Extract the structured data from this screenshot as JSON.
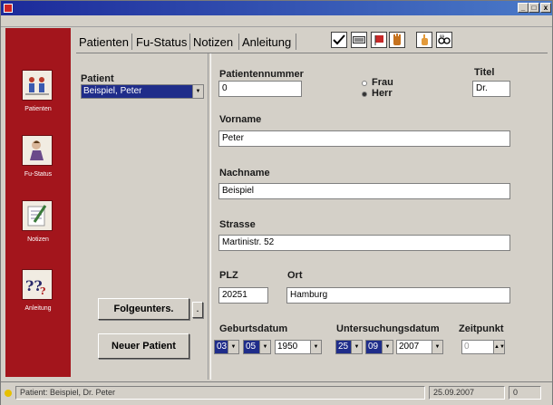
{
  "window": {
    "title": "",
    "minimize": "_",
    "maximize": "□",
    "close": "x"
  },
  "menu": [],
  "sidebar": [
    {
      "name": "patienten",
      "label": "Patienten"
    },
    {
      "name": "fu-status",
      "label": "Fu-Status"
    },
    {
      "name": "notizen",
      "label": "Notizen"
    },
    {
      "name": "anleitung",
      "label": "Anleitung"
    }
  ],
  "tabs": [
    "Patienten",
    "Fu-Status",
    "Notizen",
    "Anleitung"
  ],
  "toolbar_icons": [
    "check-icon",
    "keyboard-icon",
    "flag-icon",
    "hand-icon",
    "hand-up-icon",
    "glasses-icon"
  ],
  "left": {
    "patient_label": "Patient",
    "patient_selected": "Beispiel, Peter",
    "followup_button": "Folgeunters.",
    "small_button": ".",
    "new_patient_button": "Neuer Patient"
  },
  "form": {
    "patientennummer_label": "Patientennummer",
    "patientennummer_value": "0",
    "gender_options": [
      "Frau",
      "Herr"
    ],
    "gender_selected": "Herr",
    "titel_label": "Titel",
    "titel_value": "Dr.",
    "vorname_label": "Vorname",
    "vorname_value": "Peter",
    "nachname_label": "Nachname",
    "nachname_value": "Beispiel",
    "strasse_label": "Strasse",
    "strasse_value": "Martinistr. 52",
    "plz_label": "PLZ",
    "plz_value": "20251",
    "ort_label": "Ort",
    "ort_value": "Hamburg",
    "geburtsdatum_label": "Geburtsdatum",
    "geburt_day": "03",
    "geburt_month": "05",
    "geburt_year": "1950",
    "untersuchung_label": "Untersuchungsdatum",
    "unters_day": "25",
    "unters_month": "09",
    "unters_year": "2007",
    "zeitpunkt_label": "Zeitpunkt",
    "zeitpunkt_value": "0"
  },
  "status": {
    "patient": "Patient: Beispiel, Dr. Peter",
    "date": "25.09.2007",
    "count": "0"
  },
  "colors": {
    "sidebar": "#a3151c",
    "selection": "#1f2d8a",
    "face": "#d4d0c8"
  }
}
